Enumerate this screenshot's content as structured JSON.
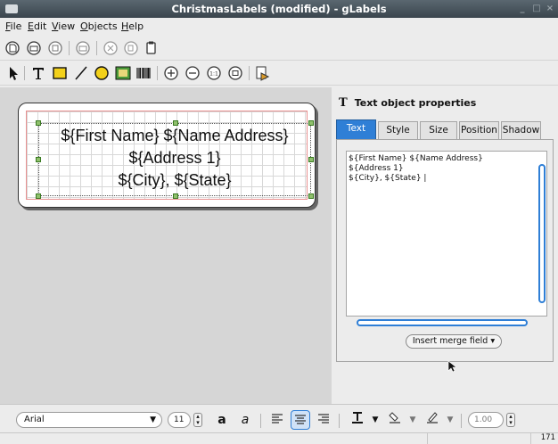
{
  "window": {
    "title": "ChristmasLabels (modified) - gLabels"
  },
  "menu": [
    {
      "label": "File",
      "u": "F"
    },
    {
      "label": "Edit",
      "u": "E"
    },
    {
      "label": "View",
      "u": "V"
    },
    {
      "label": "Objects",
      "u": "O"
    },
    {
      "label": "Help",
      "u": "H"
    }
  ],
  "label_text": {
    "line1": "${First Name} ${Name Address}",
    "line2": "${Address 1}",
    "line3": "${City}, ${State}"
  },
  "props": {
    "header": "Text object properties",
    "tabs": [
      "Text",
      "Style",
      "Size",
      "Position",
      "Shadow"
    ],
    "active_tab": "Text",
    "text_lines": [
      "${First Name} ${Name Address}",
      "${Address 1}",
      "${City}, ${State} |"
    ],
    "merge_button": "Insert merge field"
  },
  "format_bar": {
    "font": "Arial",
    "size": "11",
    "bold": "a",
    "italic": "a",
    "line_width": "1.00"
  },
  "status": {
    "zoom": "171"
  },
  "colors": {
    "accent": "#2f7fd6",
    "titlebar": "#3a454d"
  }
}
